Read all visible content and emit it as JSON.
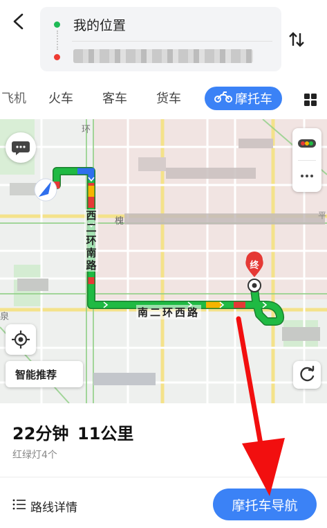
{
  "header": {
    "back_icon": "back-chevron-icon",
    "origin": "我的位置",
    "destination": "",
    "swap_icon": "swap-arrows-icon",
    "colors": {
      "origin_dot": "#1fba56",
      "destination_dot": "#ee3b32"
    }
  },
  "tabs": {
    "items": [
      {
        "label": "飞机",
        "visible_text": "飞机"
      },
      {
        "label": "火车"
      },
      {
        "label": "客车"
      },
      {
        "label": "货车"
      },
      {
        "label": "摩托车",
        "selected": true,
        "icon": "motorcycle-icon"
      }
    ],
    "more_icon": "grid-icon",
    "accent": "#3b82f6"
  },
  "map": {
    "road_labels": {
      "west": "西二环南路",
      "south": "南二环西路"
    },
    "destination_marker": "终",
    "smart_recommend": "智能推荐",
    "map_text": {
      "huan": "环",
      "ji": "槐",
      "quan": "泉",
      "pin": "平"
    },
    "icons": {
      "message": "message-icon",
      "traffic": "traffic-light-icon",
      "more": "more-dots-icon",
      "locate": "locate-icon",
      "refresh": "refresh-icon"
    },
    "route_colors": {
      "smooth": "#1aaa3b",
      "slow": "#f5b400",
      "jam": "#e53935",
      "start": "#2f6fed"
    }
  },
  "summary": {
    "duration": "22分钟",
    "distance": "11公里",
    "traffic_lights": "红绿灯4个"
  },
  "actions": {
    "route_details": "路线详情",
    "details_icon": "list-icon",
    "navigate": "摩托车导航"
  },
  "annotation": {
    "arrow_color": "#f20f0f"
  }
}
